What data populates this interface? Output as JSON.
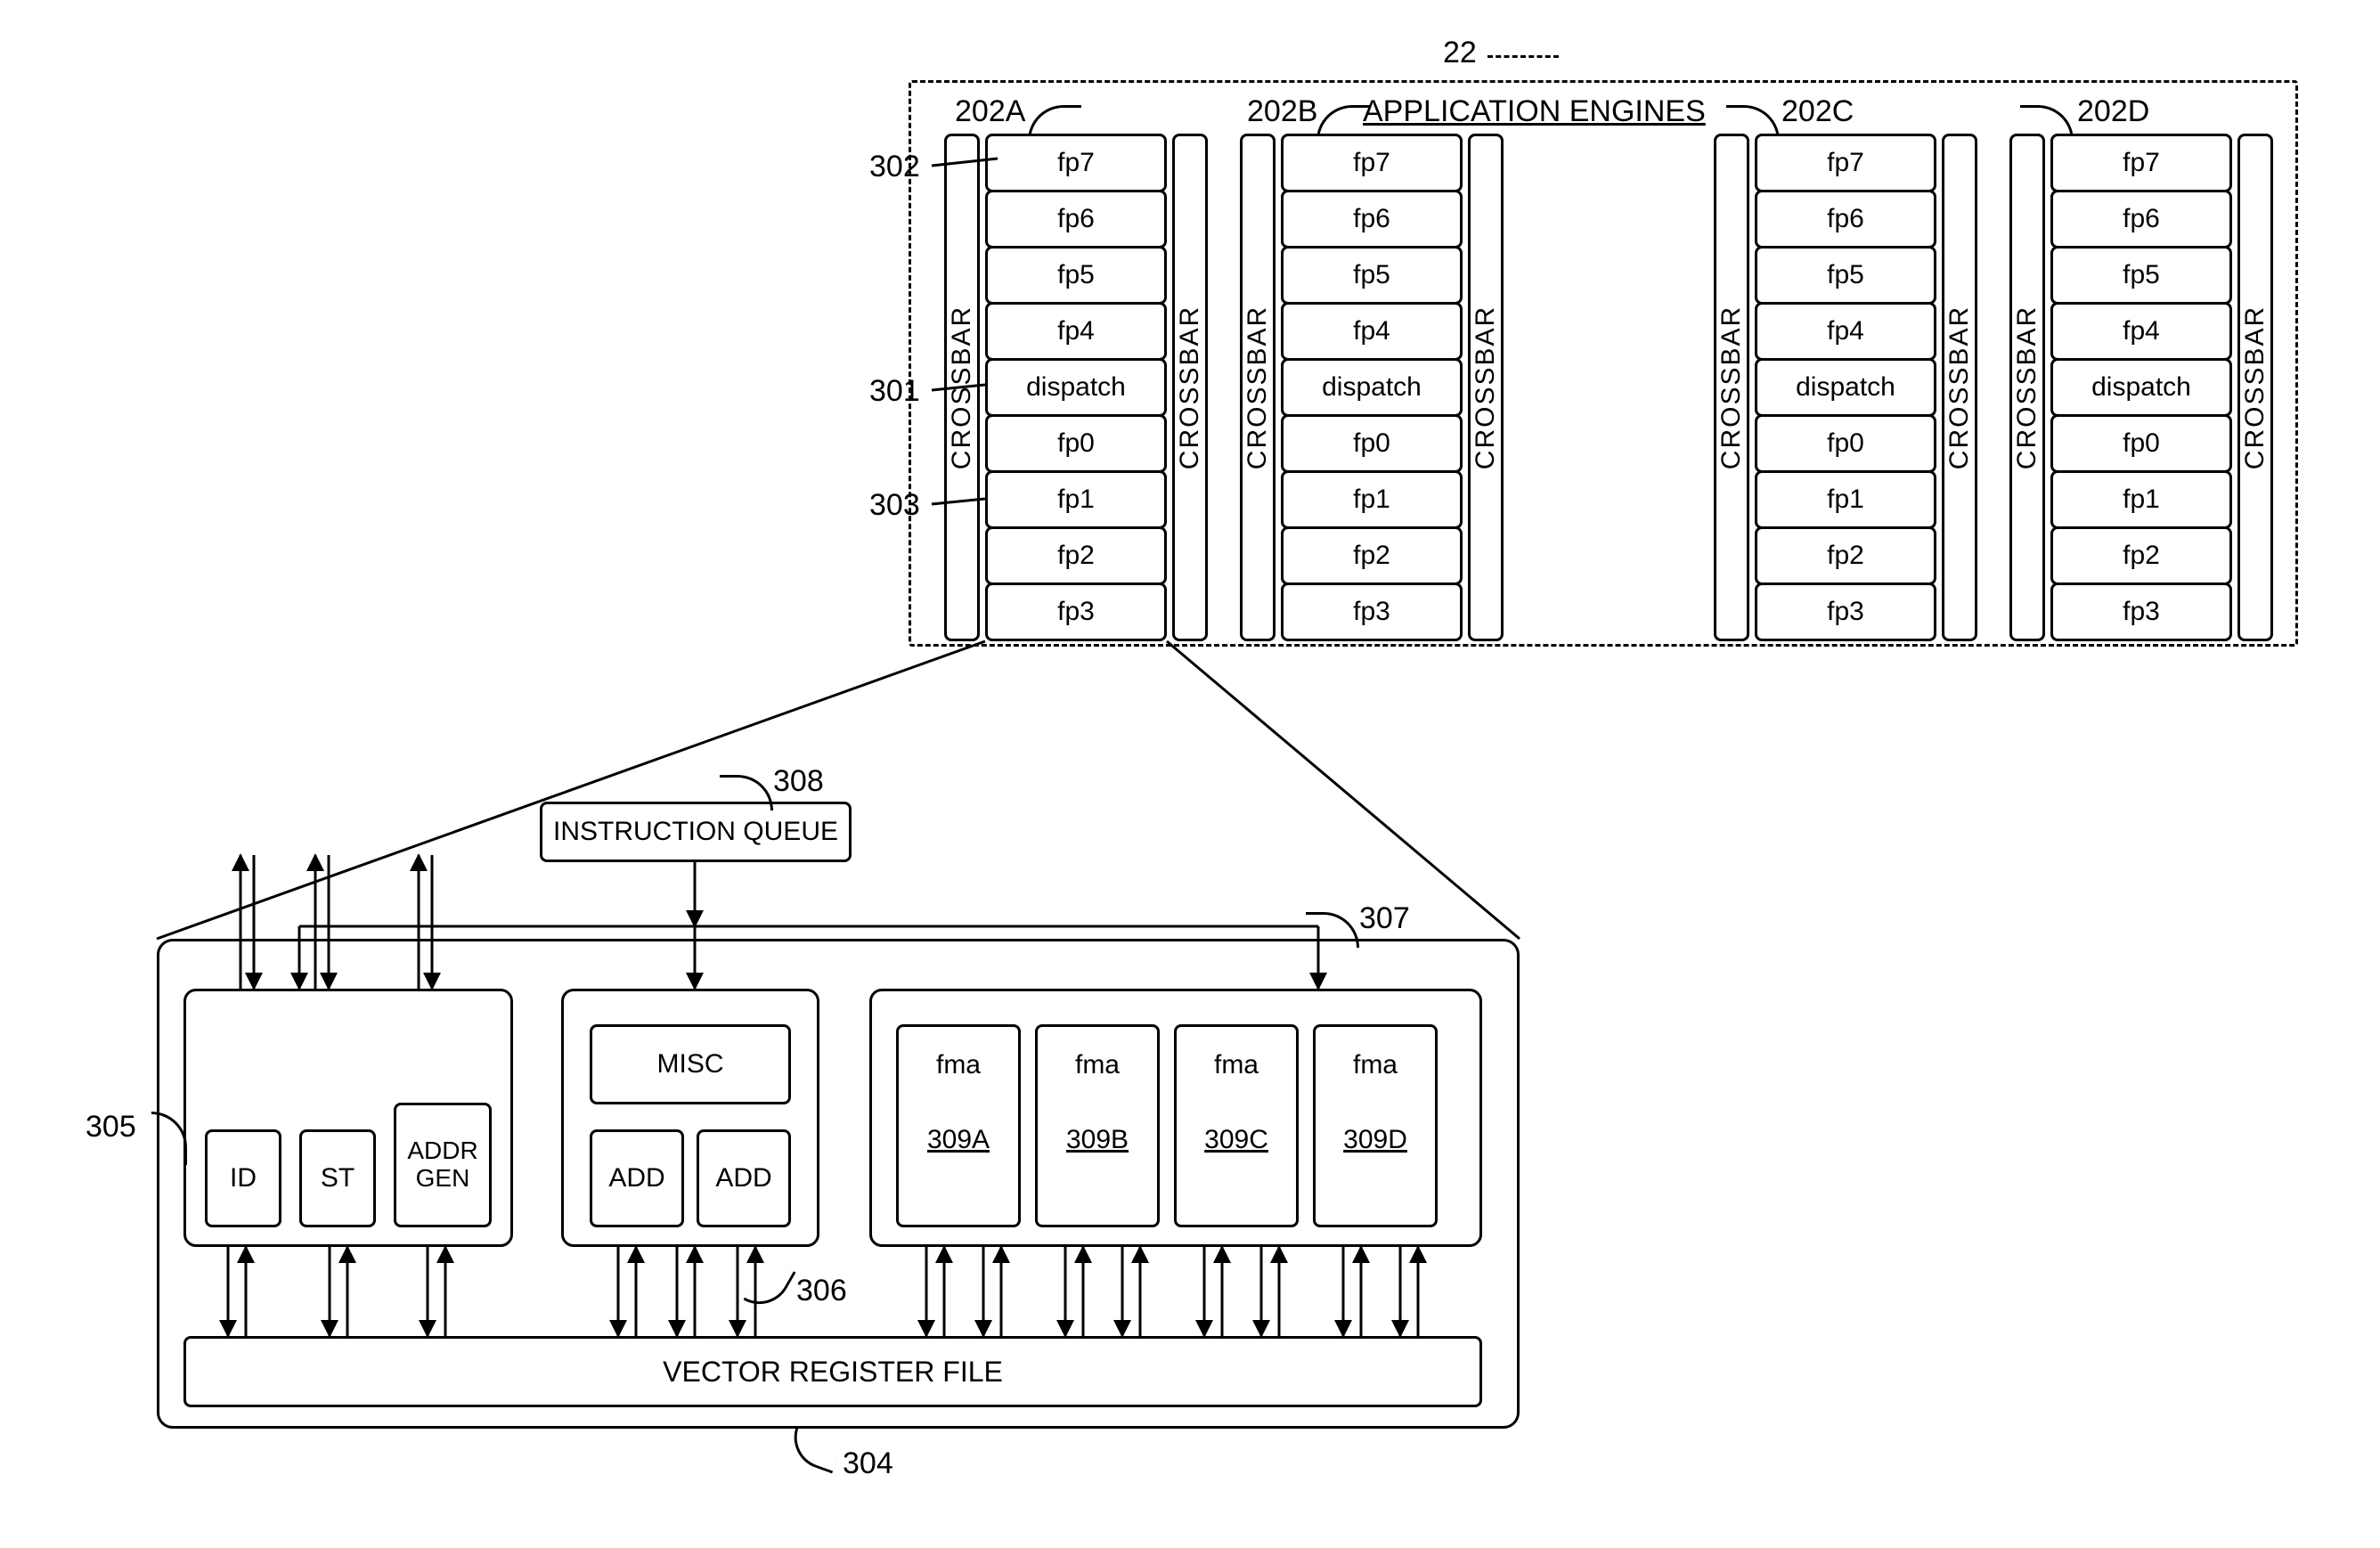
{
  "top": {
    "container_ref": "22",
    "title": "APPLICATION ENGINES",
    "crossbar_label": "CROSSBAR",
    "engines": [
      {
        "ref": "202A"
      },
      {
        "ref": "202B"
      },
      {
        "ref": "202C"
      },
      {
        "ref": "202D"
      }
    ],
    "cells": [
      "fp7",
      "fp6",
      "fp5",
      "fp4",
      "dispatch",
      "fp0",
      "fp1",
      "fp2",
      "fp3"
    ],
    "callouts": {
      "fp7": "302",
      "dispatch": "301",
      "fp1": "303"
    }
  },
  "detail": {
    "ref_outer": "304",
    "instruction_queue": {
      "label": "INSTRUCTION QUEUE",
      "ref": "308"
    },
    "left_block": {
      "ref": "305",
      "boxes": {
        "id": "ID",
        "st": "ST",
        "addr_gen": "ADDR\nGEN"
      }
    },
    "mid_block": {
      "ref": "306",
      "misc": "MISC",
      "add": "ADD"
    },
    "right_block": {
      "ref": "307",
      "fma": "fma",
      "units": [
        "309A",
        "309B",
        "309C",
        "309D"
      ]
    },
    "vrf": "VECTOR REGISTER FILE"
  },
  "chart_data": {
    "type": "diagram",
    "description": "Patent-style block diagram of a vector processor. Top: container 22 (APPLICATION ENGINES) holding four identical engines 202A–202D. Each engine has two CROSSBAR columns flanking a stack of units [fp7,fp6,fp5,fp4,dispatch,fp0,fp1,fp2,fp3]; callouts 302→fp7, 301→dispatch, 303→fp1 on engine 202A. Engine 202A is exploded into a lower detail block 304 containing: INSTRUCTION QUEUE (308) feeding three sub-blocks — 305 {ID, ST, ADDR GEN with a mux/trapezoid}, 306 {MISC, ADD, ADD}, 307 {four fma units 309A–309D}. All three feed into / read from VECTOR REGISTER FILE at the bottom. Bidirectional arrows between sub-blocks and VRF; external up/down arrows from 305.",
    "references": {
      "22": "application-engines container",
      "202A": "engine A",
      "202B": "engine B",
      "202C": "engine C",
      "202D": "engine D",
      "301": "dispatch unit",
      "302": "fp7 unit",
      "303": "fp1 unit",
      "304": "exploded fp-unit detail / vector register file assembly",
      "305": "load/store/addr-gen block",
      "306": "misc + ADD block",
      "307": "fma block",
      "308": "instruction queue",
      "309A": "fma unit A",
      "309B": "fma unit B",
      "309C": "fma unit C",
      "309D": "fma unit D"
    }
  }
}
